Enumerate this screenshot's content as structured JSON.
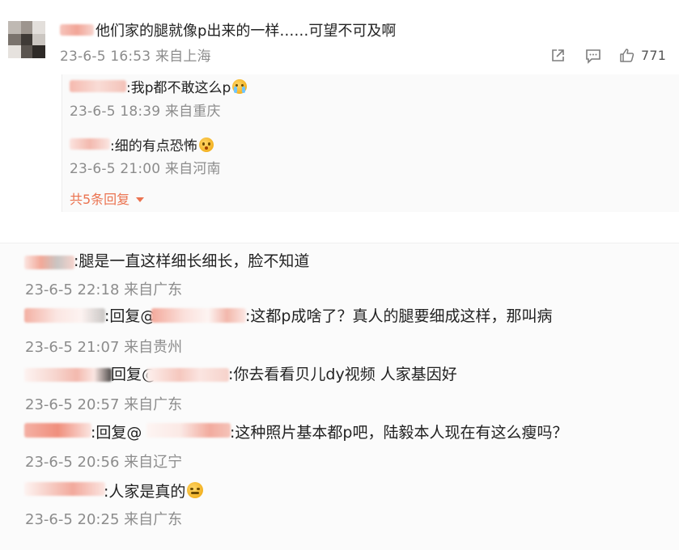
{
  "top_comment": {
    "text": "他们家的腿就像p出来的一样……可望不可及啊",
    "meta": "23-6-5 16:53 来自上海",
    "like_count": "771",
    "icons": [
      "share-icon",
      "comment-icon",
      "like-icon"
    ]
  },
  "sub_replies": [
    {
      "text": ":我p都不敢这么p",
      "meta": "23-6-5 18:39 来自重庆",
      "emoji": "crying-face"
    },
    {
      "text": ":细的有点恐怖",
      "meta": "23-6-5 21:00 来自河南",
      "emoji": "scared-cat-face"
    }
  ],
  "more_replies": "共5条回复",
  "comments": [
    {
      "text": ":腿是一直这样细长细长，脸不知道",
      "meta": "23-6-5 22:18 来自广东"
    },
    {
      "text_a": ":回复@",
      "text_b": ":这都p成啥了？真人的腿要细成这样，那叫病",
      "meta": "23-6-5 21:07 来自贵州"
    },
    {
      "text_a": "回复@",
      "text_b": ":你去看看贝儿dy视频 人家基因好",
      "meta": "23-6-5 20:57 来自广东"
    },
    {
      "text_a": ":回复@",
      "text_b": ":这种照片基本都p吧，陆毅本人现在有这么瘦吗？",
      "meta": "23-6-5 20:56 来自辽宁"
    },
    {
      "text": ":人家是真的",
      "meta": "23-6-5 20:25 来自广东",
      "emoji": "face-emoji"
    }
  ]
}
